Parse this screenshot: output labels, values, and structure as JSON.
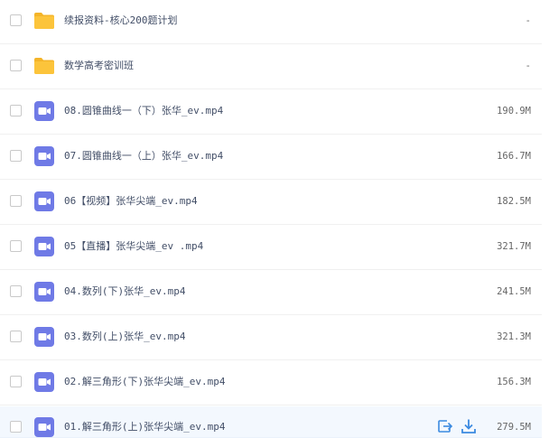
{
  "colors": {
    "folder": "#fcc43b",
    "folder_dark": "#f4b429",
    "video": "#6f7ae6",
    "accent": "#3b8ae0",
    "text": "#424e67",
    "size_text": "#666666",
    "hover_row": "#f3f8fe"
  },
  "files": [
    {
      "name": "续报资料-核心200题计划",
      "size": "-",
      "icon": "folder-icon",
      "type": "folder"
    },
    {
      "name": "数学高考密训班",
      "size": "-",
      "icon": "folder-icon",
      "type": "folder"
    },
    {
      "name": "08.圆锥曲线一（下）张华_ev.mp4",
      "size": "190.9M",
      "icon": "video-file-icon",
      "type": "video"
    },
    {
      "name": "07.圆锥曲线一（上）张华_ev.mp4",
      "size": "166.7M",
      "icon": "video-file-icon",
      "type": "video"
    },
    {
      "name": "06【视频】张华尖端_ev.mp4",
      "size": "182.5M",
      "icon": "video-file-icon",
      "type": "video"
    },
    {
      "name": "05【直播】张华尖端_ev .mp4",
      "size": "321.7M",
      "icon": "video-file-icon",
      "type": "video"
    },
    {
      "name": "04.数列(下)张华_ev.mp4",
      "size": "241.5M",
      "icon": "video-file-icon",
      "type": "video"
    },
    {
      "name": "03.数列(上)张华_ev.mp4",
      "size": "321.3M",
      "icon": "video-file-icon",
      "type": "video"
    },
    {
      "name": "02.解三角形(下)张华尖端_ev.mp4",
      "size": "156.3M",
      "icon": "video-file-icon",
      "type": "video"
    },
    {
      "name": "01.解三角形(上)张华尖端_ev.mp4",
      "size": "279.5M",
      "icon": "video-file-icon",
      "type": "video",
      "hovered": true
    }
  ],
  "row_actions": {
    "share_icon": "share-icon",
    "download_icon": "download-icon"
  }
}
